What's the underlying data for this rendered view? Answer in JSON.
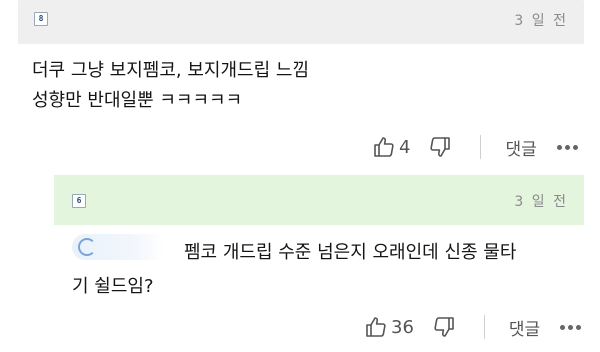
{
  "comment": {
    "level_badge": "8",
    "time": "3 일 전",
    "body_line1": "더쿠 그냥 보지펨코, 보지개드립 느낌",
    "body_line2": "성향만 반대일뿐 ㅋㅋㅋㅋㅋ",
    "like_count": "4",
    "reply_label": "댓글"
  },
  "reply": {
    "level_badge": "6",
    "time": "3 일 전",
    "body_line1": "펨코 개드립 수준 넘은지 오래인데 신종 물타",
    "body_line2": "기 쉴드임?",
    "like_count": "36",
    "reply_label": "댓글"
  },
  "icons": {
    "like": "thumbs-up-icon",
    "dislike": "thumbs-down-icon",
    "more": "more-dots-icon",
    "mention": "mention-icon"
  },
  "colors": {
    "comment_header_bg": "#efefef",
    "reply_header_bg": "#e3f5dd"
  }
}
